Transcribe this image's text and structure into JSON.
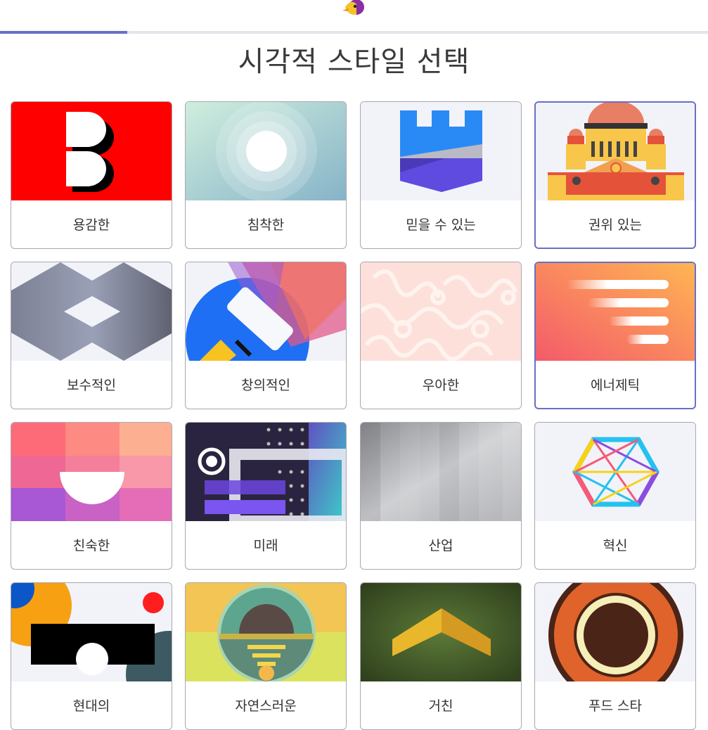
{
  "header": {
    "logo": "bird-logo-icon"
  },
  "progress": {
    "percent": 18
  },
  "page": {
    "title": "시각적 스타일 선택"
  },
  "styles": [
    {
      "label": "용감한",
      "icon": "bold-b-icon",
      "selected": false
    },
    {
      "label": "침착한",
      "icon": "calm-circles-icon",
      "selected": false
    },
    {
      "label": "믿을 수 있는",
      "icon": "castle-shield-icon",
      "selected": false
    },
    {
      "label": "권위 있는",
      "icon": "capitol-building-icon",
      "selected": true
    },
    {
      "label": "보수적인",
      "icon": "geometric-pattern-icon",
      "selected": false
    },
    {
      "label": "창의적인",
      "icon": "paint-roller-icon",
      "selected": false
    },
    {
      "label": "우아한",
      "icon": "damask-pattern-icon",
      "selected": false
    },
    {
      "label": "에너제틱",
      "icon": "speed-lines-icon",
      "selected": true
    },
    {
      "label": "친숙한",
      "icon": "friendly-blocks-icon",
      "selected": false
    },
    {
      "label": "미래",
      "icon": "futuristic-panel-icon",
      "selected": false
    },
    {
      "label": "산업",
      "icon": "brushed-metal-icon",
      "selected": false
    },
    {
      "label": "혁신",
      "icon": "hexagon-network-icon",
      "selected": false
    },
    {
      "label": "현대의",
      "icon": "modern-shapes-icon",
      "selected": false
    },
    {
      "label": "자연스러운",
      "icon": "nature-sunset-icon",
      "selected": false
    },
    {
      "label": "거친",
      "icon": "rugged-chevron-icon",
      "selected": false
    },
    {
      "label": "푸드 스타",
      "icon": "food-plate-icon",
      "selected": false
    }
  ]
}
